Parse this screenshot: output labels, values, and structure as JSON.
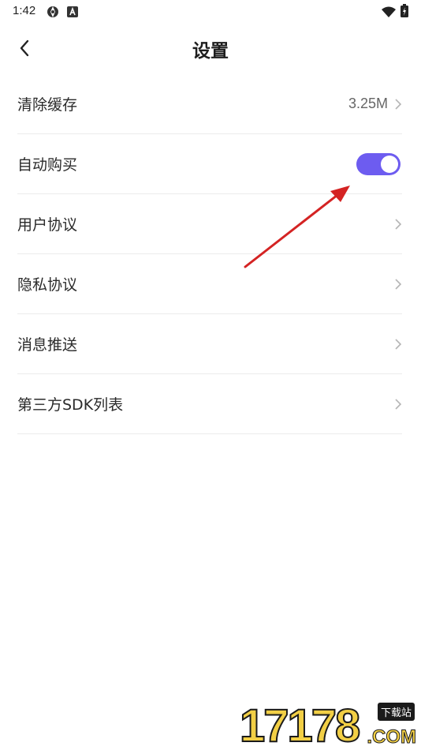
{
  "status_bar": {
    "time": "1:42"
  },
  "header": {
    "title": "设置"
  },
  "settings": [
    {
      "label": "清除缓存",
      "value": "3.25M",
      "control": "chevron"
    },
    {
      "label": "自动购买",
      "control": "toggle",
      "toggle_on": true
    },
    {
      "label": "用户协议",
      "control": "chevron"
    },
    {
      "label": "隐私协议",
      "control": "chevron"
    },
    {
      "label": "消息推送",
      "control": "chevron"
    },
    {
      "label": "第三方SDK列表",
      "control": "chevron"
    }
  ],
  "colors": {
    "toggle_accent": "#6d5cf0",
    "annotation_arrow": "#d42323",
    "watermark_yellow": "#f2cf45"
  },
  "icons": {
    "back": "chevron-left-icon",
    "row_arrow": "chevron-right-icon"
  },
  "watermark": {
    "digits": "17178",
    "tag": "下载站",
    "domain": ".COM"
  }
}
